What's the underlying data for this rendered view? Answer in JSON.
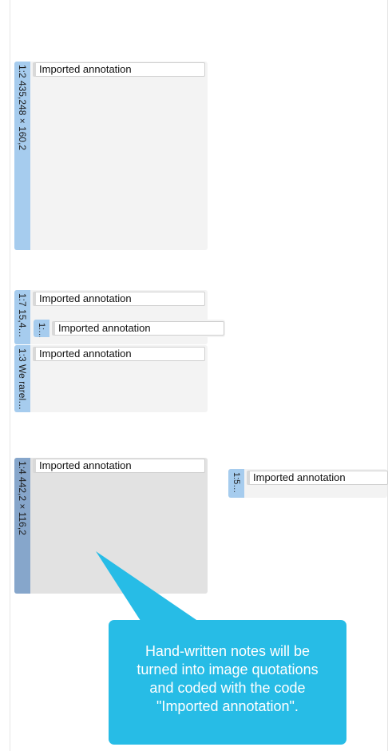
{
  "quotations": [
    {
      "tab_label": "1:2 435,248 × 160,2",
      "code": "Imported annotation"
    },
    {
      "tab_label": "1:7 15,4…",
      "code": "Imported annotation"
    },
    {
      "tab_label": "1:…",
      "code": "Imported annotation"
    },
    {
      "tab_label": "1:3 We rarel…",
      "code": "Imported annotation"
    },
    {
      "tab_label": "1:4 442,2 × 116,2",
      "code": "Imported annotation"
    },
    {
      "tab_label": "1:5…",
      "code": "Imported annotation"
    }
  ],
  "callout": {
    "lines": [
      "Hand-written notes will be",
      "turned into image quotations",
      "and coded with the code",
      "\"Imported annotation\"."
    ]
  },
  "colors": {
    "tab": "#a6ccee",
    "tab_selected": "#86a6cb",
    "quote_bg": "#f3f3f3",
    "quote_selected_bg": "#e2e2e2",
    "callout": "#27bce6"
  }
}
